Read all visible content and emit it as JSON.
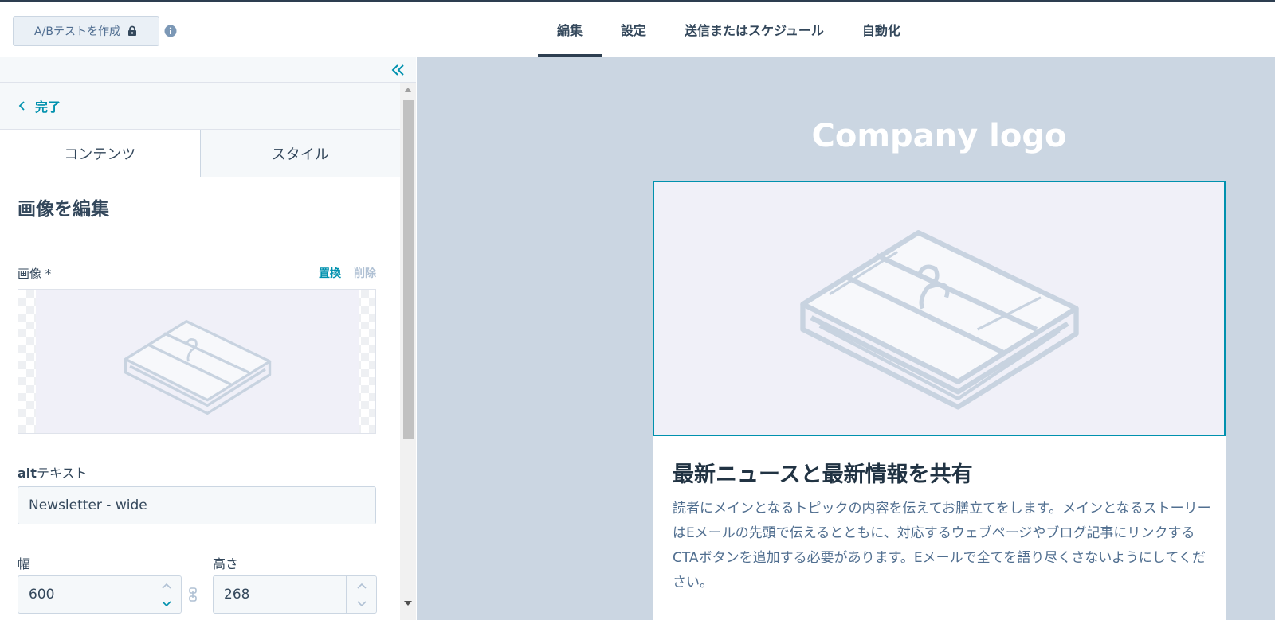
{
  "header": {
    "ab_test_label": "A/Bテストを作成",
    "tabs": [
      {
        "label": "編集",
        "active": true
      },
      {
        "label": "設定",
        "active": false
      },
      {
        "label": "送信またはスケジュール",
        "active": false
      },
      {
        "label": "自動化",
        "active": false
      }
    ]
  },
  "sidebar": {
    "back_label": "完了",
    "tabs": [
      {
        "label": "コンテンツ",
        "active": true
      },
      {
        "label": "スタイル",
        "active": false
      }
    ],
    "section_title": "画像を編集",
    "image_label": "画像 *",
    "replace_label": "置換",
    "delete_label": "削除",
    "alt_label_bold": "alt",
    "alt_label_rest": "テキスト",
    "alt_value": "Newsletter - wide",
    "width_label": "幅",
    "width_value": "600",
    "height_label": "高さ",
    "height_value": "268"
  },
  "preview": {
    "company_logo": "Company logo",
    "article_title": "最新ニュースと最新情報を共有",
    "article_body": "読者にメインとなるトピックの内容を伝えてお膳立てをします。メインとなるストーリーはEメールの先頭で伝えるとともに、対応するウェブページやブログ記事にリンクするCTAボタンを追加する必要があります。Eメールで全てを語り尽くさないようにしてください。"
  },
  "colors": {
    "accent": "#0091ae",
    "dark": "#2d3e50",
    "preview_bg": "#cbd6e2",
    "image_bg": "#f0f0f8"
  },
  "icons": [
    "lock-icon",
    "info-icon",
    "double-chevron-left-icon",
    "chevron-left-icon",
    "link-icon",
    "chevron-up-icon",
    "chevron-down-icon",
    "newsletter-illustration"
  ]
}
